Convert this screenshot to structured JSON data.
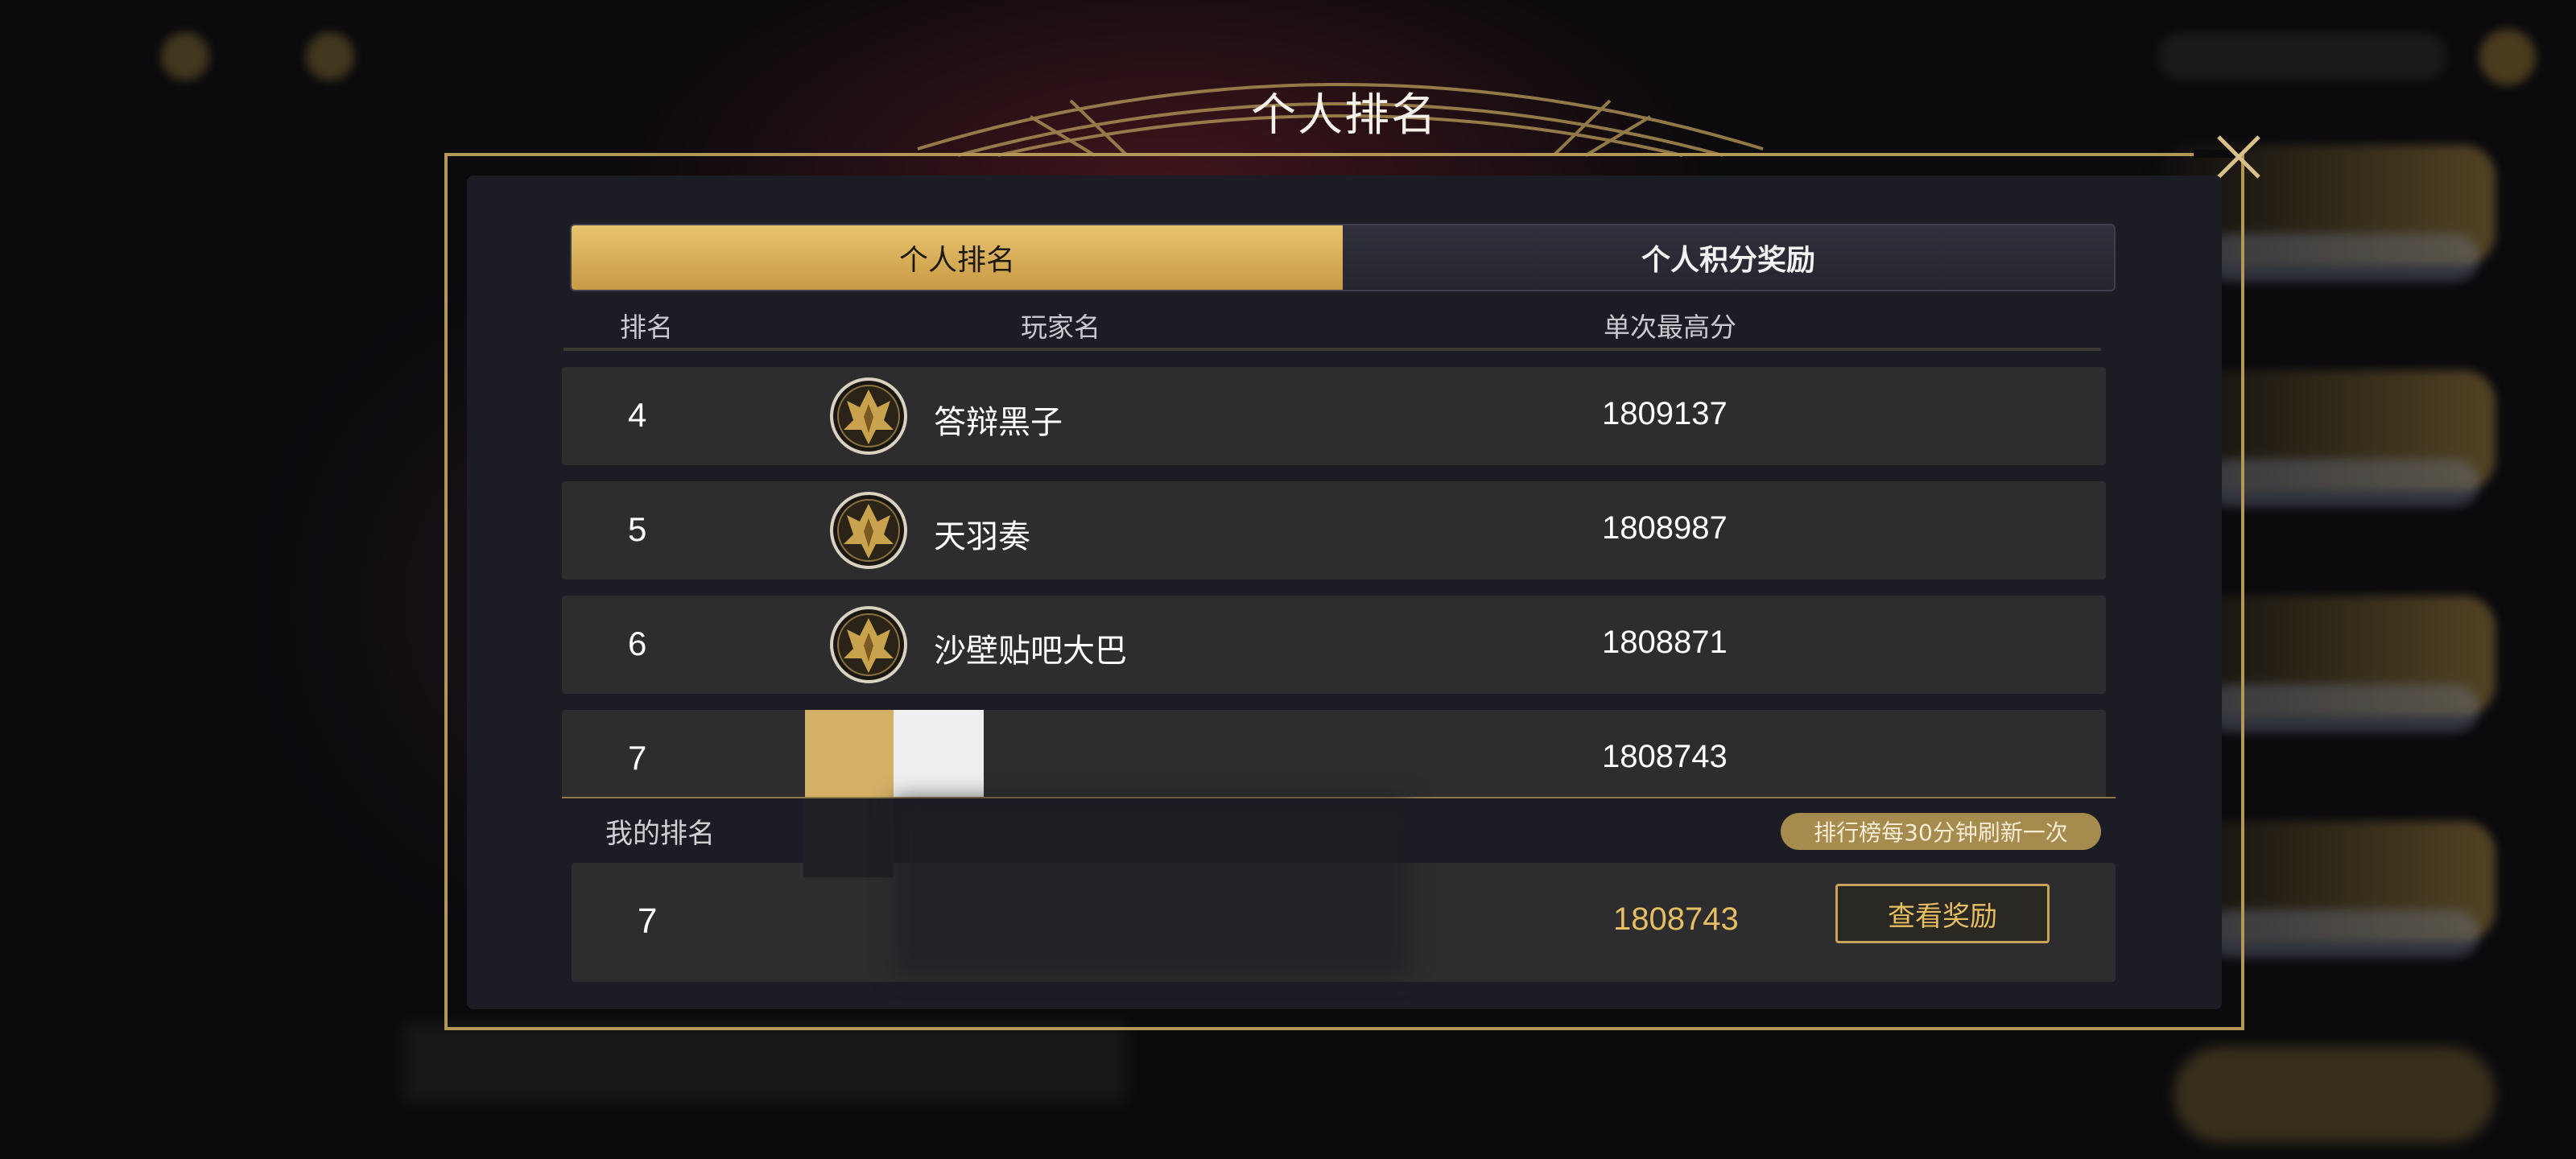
{
  "modal": {
    "title": "个人排名",
    "tabs": [
      {
        "label": "个人排名",
        "active": true
      },
      {
        "label": "个人积分奖励",
        "active": false
      }
    ]
  },
  "table": {
    "headers": {
      "rank": "排名",
      "player": "玩家名",
      "score": "单次最高分"
    },
    "rows": [
      {
        "rank": "4",
        "name": "答辩黑子",
        "score": "1809137"
      },
      {
        "rank": "5",
        "name": "天羽奏",
        "score": "1808987"
      },
      {
        "rank": "6",
        "name": "沙壁贴吧大巴",
        "score": "1808871"
      },
      {
        "rank": "7",
        "name": "",
        "score": "1808743"
      }
    ]
  },
  "my_rank": {
    "label": "我的排名",
    "refresh_note": "排行榜每30分钟刷新一次",
    "rank": "7",
    "score": "1808743",
    "reward_button": "查看奖励"
  },
  "colors": {
    "accent_gold": "#e8be63",
    "frame_gold": "#b39757",
    "row_bg": "#2d2d2f",
    "panel_bg": "#1c1c24"
  },
  "icons": {
    "close": "close-icon",
    "avatar": "gold-crest-avatar-icon"
  }
}
